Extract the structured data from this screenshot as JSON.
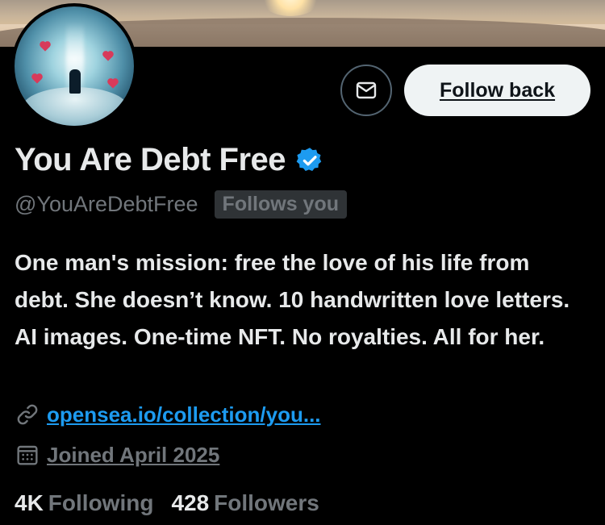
{
  "profile": {
    "display_name": "You Are Debt Free",
    "handle": "@YouAreDebtFree",
    "follows_you_badge": "Follows you",
    "verified": true,
    "bio": "One man's mission: free the love of his life from debt. She doesn’t know. 10 handwritten love letters. AI images. One-time NFT. No royalties. All for her.",
    "link": "opensea.io/collection/you...",
    "joined": "Joined April 2025"
  },
  "actions": {
    "message_icon": "envelope-icon",
    "follow_back_label": "Follow back"
  },
  "stats": {
    "following_count": "4K",
    "following_label": "Following",
    "followers_count": "428",
    "followers_label": "Followers"
  },
  "colors": {
    "background": "#000000",
    "accent": "#1d9bf0",
    "verified_badge": "#1d9bf0",
    "secondary_text": "#71767b",
    "button_bg": "#eff3f4"
  },
  "icons": {
    "link": "link-icon",
    "calendar": "calendar-icon",
    "verified": "verified-badge-icon"
  }
}
